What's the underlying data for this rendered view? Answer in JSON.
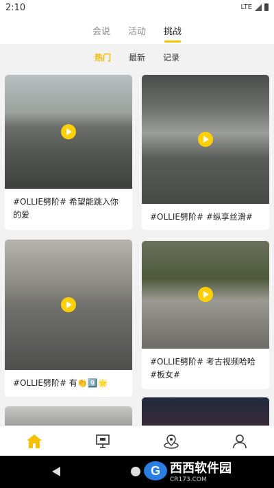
{
  "status_bar": {
    "time": "2:10",
    "network": "LTE"
  },
  "top_tabs": [
    {
      "label": "会说",
      "active": false
    },
    {
      "label": "活动",
      "active": false
    },
    {
      "label": "挑战",
      "active": true
    }
  ],
  "sub_tabs": [
    {
      "label": "热门",
      "active": true
    },
    {
      "label": "最新",
      "active": false
    },
    {
      "label": "记录",
      "active": false
    }
  ],
  "cards": [
    {
      "caption": "#OLLIE劈阶# 希望能跳入你的爱"
    },
    {
      "caption": "#OLLIE劈阶# #纵享丝滑#"
    },
    {
      "caption": "#OLLIE劈阶# 有👏9️⃣🌟"
    },
    {
      "caption": "#OLLIE劈阶# 考古视频哈哈#板女#"
    },
    {
      "caption": ""
    },
    {
      "caption": ""
    }
  ],
  "bottom_nav": [
    {
      "icon": "home-icon",
      "active": true
    },
    {
      "icon": "presentation-icon",
      "active": false
    },
    {
      "icon": "map-pin-icon",
      "active": false
    },
    {
      "icon": "person-icon",
      "active": false
    }
  ],
  "watermark": {
    "logo": "G",
    "name": "西西软件园",
    "url": "CR173.COM"
  },
  "colors": {
    "accent": "#f5c000",
    "active_tab": "#f5b800",
    "inactive": "#888888"
  }
}
